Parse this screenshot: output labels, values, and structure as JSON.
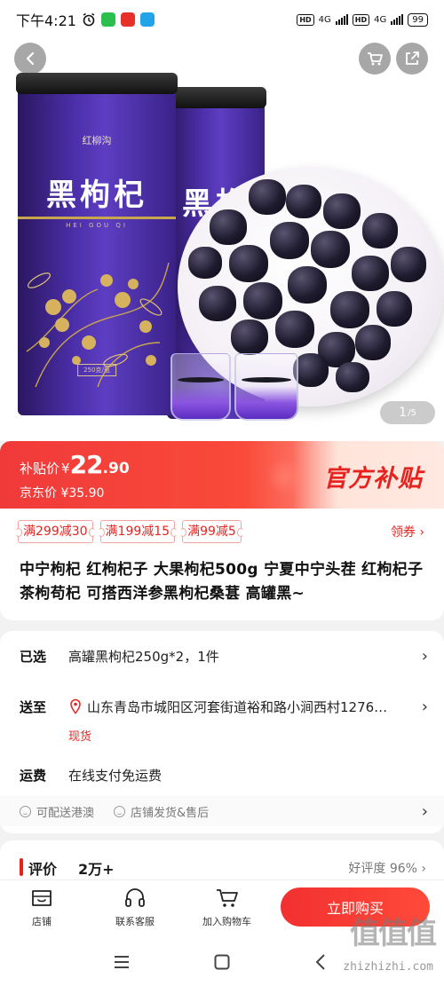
{
  "status_bar": {
    "time": "下午4:21",
    "network_1": "4G",
    "network_2": "4G",
    "hd_1": "HD",
    "hd_2": "HD",
    "battery": "99"
  },
  "gallery": {
    "current_page": "1",
    "total_pages": "/5",
    "can_title": "黑枸杞",
    "can_brand": "红柳沟",
    "can_sub": "HEI GOU QI",
    "can_weight": "250克/瓶"
  },
  "price": {
    "subsidy_label": "补贴价",
    "currency": "¥",
    "price_int": "22",
    "price_dec": ".90",
    "jd_label": "京东价",
    "jd_price": "¥35.90",
    "official_subsidy": "官方补贴"
  },
  "coupons": [
    "满299减30",
    "满199减15",
    "满99减5"
  ],
  "collect_coupon": "领券 ›",
  "product_title": "中宁枸杞 红枸杞子 大果枸杞500g 宁夏中宁头茬 红枸杞子茶枸苟杞 可搭西洋参黑枸杞桑葚 高罐黑~",
  "specs": {
    "selected_key": "已选",
    "selected_val": "高罐黑枸杞250g*2，1件",
    "ship_key": "送至",
    "ship_val": "山东青岛市城阳区河套街道裕和路小涧西村1276…",
    "stock": "现货",
    "freight_key": "运费",
    "freight_val": "在线支付免运费",
    "service_1": "可配送港澳",
    "service_2": "店铺发货&售后"
  },
  "review": {
    "title": "评价",
    "count": "2万+",
    "rate": "好评度 96% ›"
  },
  "actions": {
    "shop": "店铺",
    "service": "联系客服",
    "cart": "加入购物车",
    "buy": "立即购买"
  },
  "watermark": {
    "mark": "值值值",
    "url": "zhizhizhi.com"
  }
}
